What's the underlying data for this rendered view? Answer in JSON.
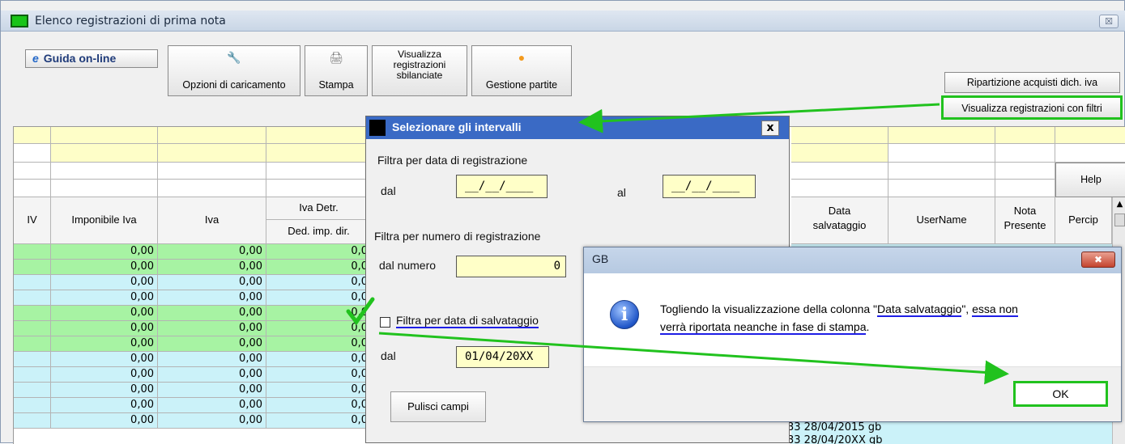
{
  "window": {
    "title": "Elenco registrazioni di prima nota",
    "close": "☒"
  },
  "toolbar": {
    "guida": "Guida on-line",
    "opzioni": "Opzioni di caricamento",
    "stampa": "Stampa",
    "visualizza_sbilanciate": [
      "Visualizza",
      "registrazioni",
      "sbilanciate"
    ],
    "gestione": "Gestione partite",
    "ripartizione": "Ripartizione acquisti dich. iva",
    "filtri": "Visualizza registrazioni con filtri",
    "help": "Help"
  },
  "grid": {
    "headers": {
      "iv": "IV",
      "imponibile": "Imponibile Iva",
      "iva": "Iva",
      "iva_detr": "Iva Detr.",
      "ded_imp": "Ded. imp. dir.",
      "data_salv": [
        "Data",
        "salvataggio"
      ],
      "username": "UserName",
      "nota": [
        "Nota",
        "Presente"
      ],
      "percip": "Percip"
    },
    "rows": [
      {
        "imponibile": "0,00",
        "iva": "0,00",
        "detr": "0,0"
      },
      {
        "imponibile": "0,00",
        "iva": "0,00",
        "detr": "0,0"
      },
      {
        "imponibile": "0,00",
        "iva": "0,00",
        "detr": "0,0"
      },
      {
        "imponibile": "0,00",
        "iva": "0,00",
        "detr": "0,0"
      },
      {
        "imponibile": "0,00",
        "iva": "0,00",
        "detr": "0,0"
      },
      {
        "imponibile": "0,00",
        "iva": "0,00",
        "detr": "0,0"
      },
      {
        "imponibile": "0,00",
        "iva": "0,00",
        "detr": "0,0"
      },
      {
        "imponibile": "0,00",
        "iva": "0,00",
        "detr": "0,0"
      },
      {
        "imponibile": "0,00",
        "iva": "0,00",
        "detr": "0,0"
      },
      {
        "imponibile": "0,00",
        "iva": "0,00",
        "detr": "0,0"
      },
      {
        "imponibile": "0,00",
        "iva": "0,00",
        "detr": "0,0"
      },
      {
        "imponibile": "0,00",
        "iva": "0,00",
        "detr": "0,0"
      }
    ],
    "partial_rows": [
      "33 28/04/2015 gb",
      "33 28/04/20XX gb"
    ]
  },
  "dialog_intervalli": {
    "title": "Selezionare gli intervalli",
    "close": "x",
    "filtra_data_reg": "Filtra per data di registrazione",
    "dal": "dal",
    "al": "al",
    "date_placeholder": "__/__/____",
    "filtra_numero": "Filtra per numero di registrazione",
    "dal_numero": "dal numero",
    "numero_value": "0",
    "filtra_salvataggio": "Filtra per data di salvataggio",
    "dal2": "dal",
    "data_salv_value": "01/04/20XX",
    "pulisci": "Pulisci campi"
  },
  "dialog_gb": {
    "title": "GB",
    "close": "✖",
    "msg_line1_a": "Togliendo la visualizzazione della colonna \"",
    "msg_line1_b": "Data salvataggio",
    "msg_line1_c": "\", ",
    "msg_line1_d": "essa non",
    "msg_line2": "verrà riportata neanche in fase di stampa",
    "msg_line2_end": ".",
    "ok": "OK"
  },
  "colors": {
    "highlight_green": "#21c21e",
    "annotation_blue": "#1e1ee6",
    "row_green": "#a7f3a3",
    "row_cyan": "#cbf2f9"
  }
}
